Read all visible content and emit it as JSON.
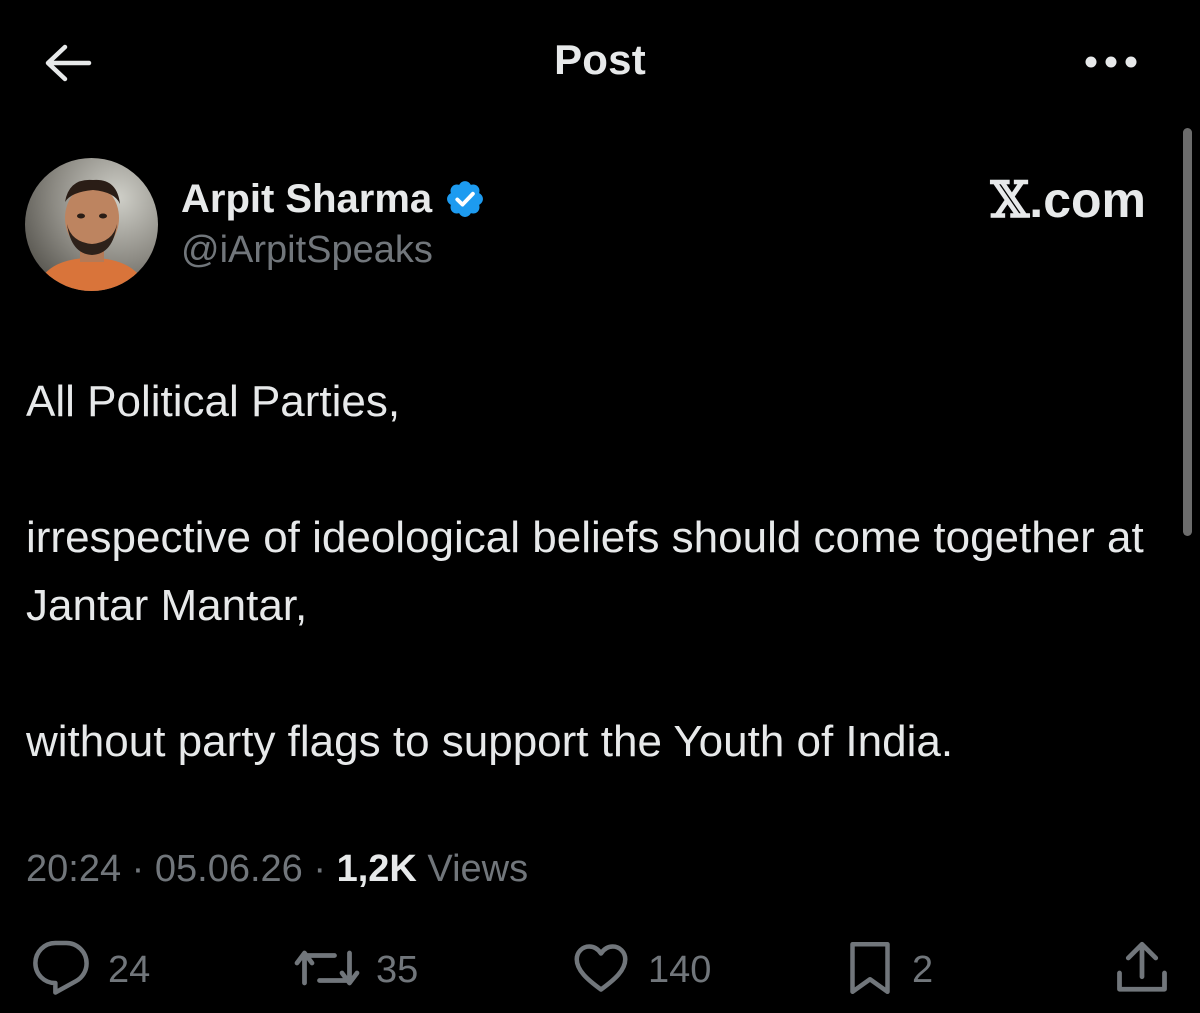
{
  "header": {
    "title": "Post",
    "back_icon": "arrow-left-icon",
    "more_icon": "more-horizontal-icon"
  },
  "author": {
    "display_name": "Arpit Sharma",
    "handle": "@iArpitSpeaks",
    "verified": true,
    "verified_color": "#1d9bf0"
  },
  "watermark": {
    "x": "𝕏",
    "domain": ".com"
  },
  "post": {
    "paragraphs": [
      "All Political Parties,",
      "irrespective of ideological beliefs should come together at Jantar Mantar,",
      "without party flags to support the Youth of India."
    ]
  },
  "meta": {
    "time": "20:24",
    "date": "05.06.26",
    "separator": "·",
    "views_count": "1,2K",
    "views_label": "Views"
  },
  "actions": {
    "replies": {
      "icon": "reply-icon",
      "count": "24"
    },
    "reposts": {
      "icon": "repost-icon",
      "count": "35"
    },
    "likes": {
      "icon": "heart-icon",
      "count": "140"
    },
    "bookmarks": {
      "icon": "bookmark-icon",
      "count": "2"
    },
    "share": {
      "icon": "share-icon"
    }
  },
  "colors": {
    "background": "#000000",
    "text_primary": "#e7e9ea",
    "text_secondary": "#71767b",
    "verified_blue": "#1d9bf0"
  }
}
